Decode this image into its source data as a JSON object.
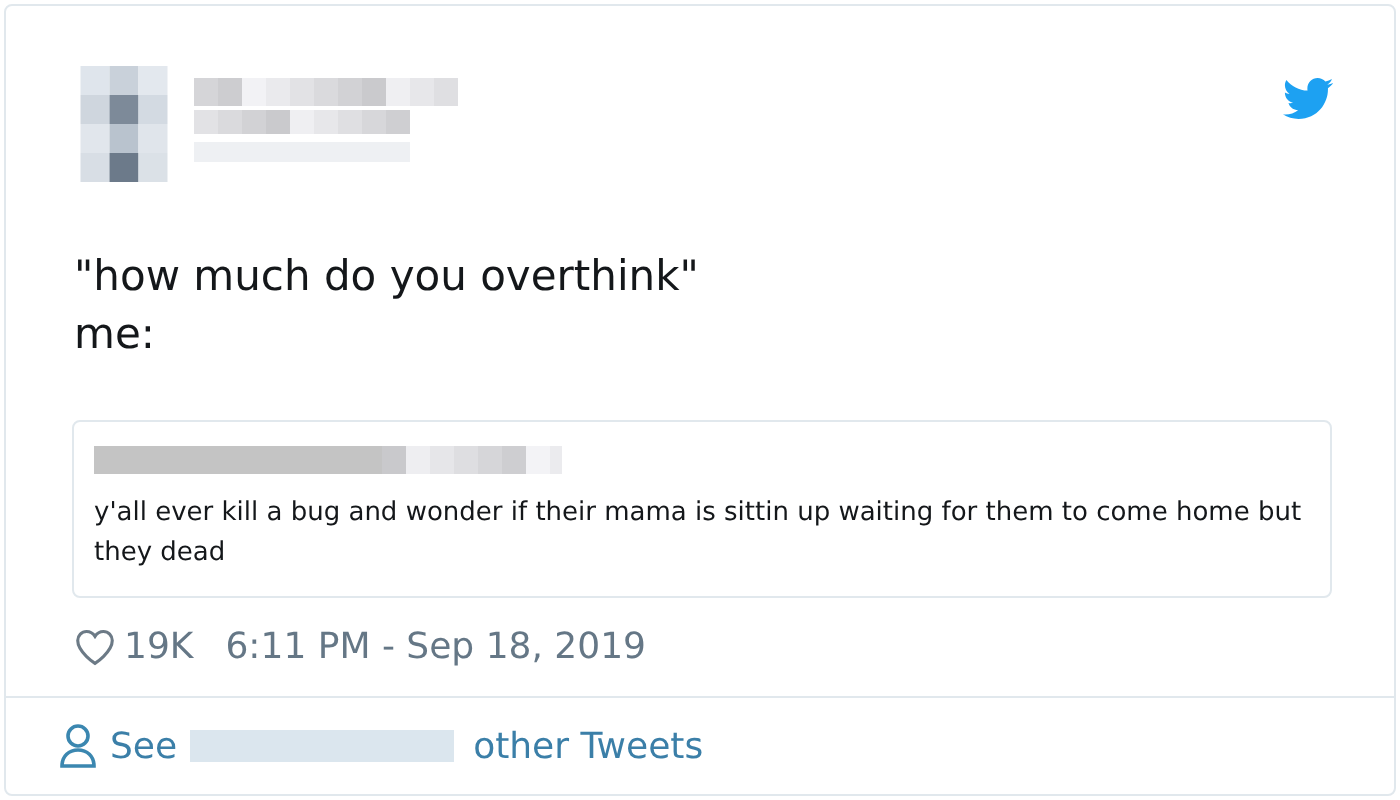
{
  "tweet": {
    "text_lines": [
      "\"how much do you overthink\"",
      "me:"
    ]
  },
  "quoted_tweet": {
    "text": "y'all ever kill a bug and wonder if their mama is sittin up waiting for them to come home but they dead"
  },
  "likes": "19K",
  "timestamp": "6:11 PM - Sep 18, 2019",
  "footer": {
    "before": "See",
    "after": "other Tweets"
  }
}
